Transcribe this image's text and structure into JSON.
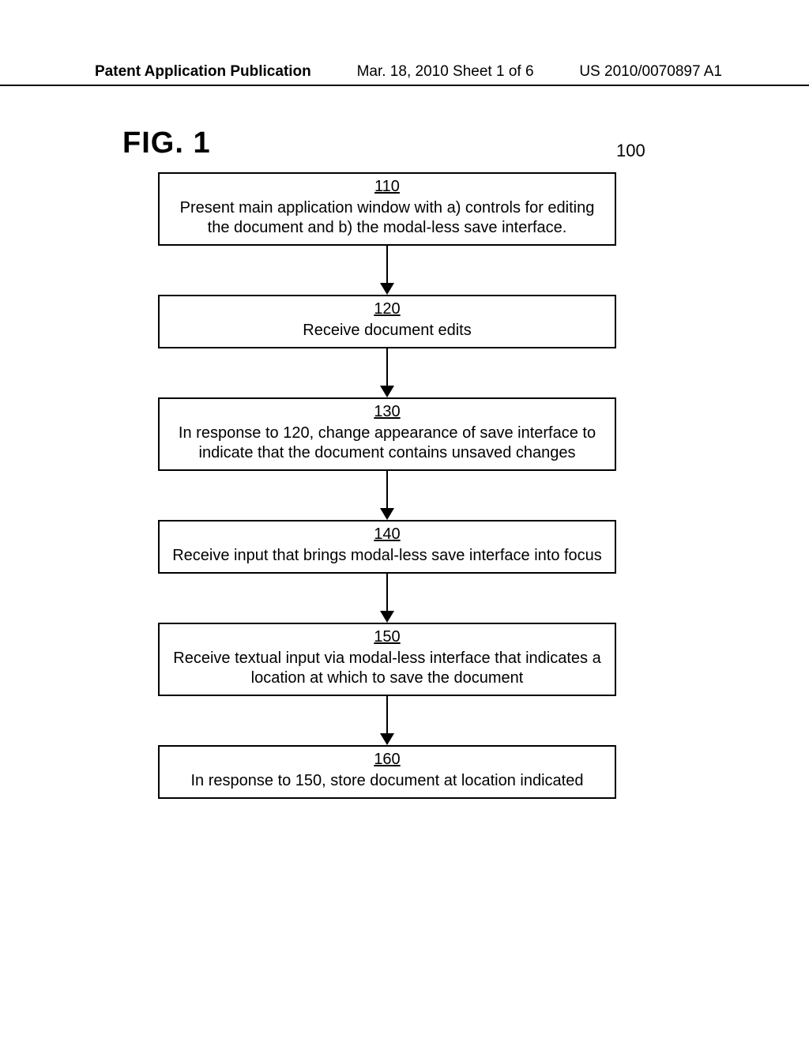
{
  "header": {
    "left": "Patent Application Publication",
    "mid": "Mar. 18, 2010  Sheet 1 of 6",
    "right": "US 2010/0070897 A1"
  },
  "figure": {
    "label": "FIG. 1",
    "number": "100",
    "steps": [
      {
        "num": "110",
        "text": "Present main application window with a) controls for editing the document and b) the modal-less save interface."
      },
      {
        "num": "120",
        "text": "Receive document edits"
      },
      {
        "num": "130",
        "text": "In response to 120, change appearance of save interface to indicate that the document contains unsaved changes"
      },
      {
        "num": "140",
        "text": "Receive input that brings modal-less save interface into focus"
      },
      {
        "num": "150",
        "text": "Receive textual input via modal-less interface that indicates a location at which to save the document"
      },
      {
        "num": "160",
        "text": "In response to 150, store document at location indicated"
      }
    ]
  }
}
